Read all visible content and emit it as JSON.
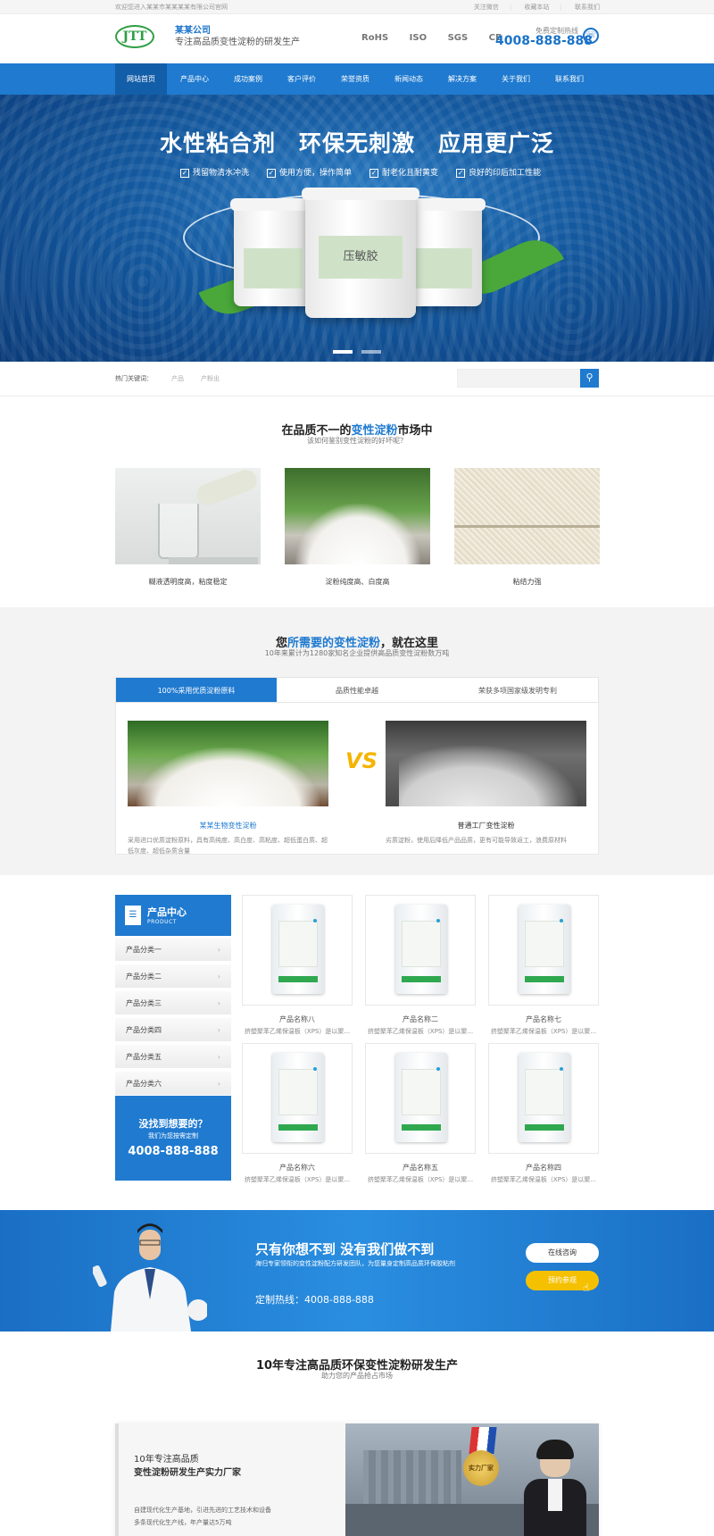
{
  "topbar": {
    "welcome": "欢迎您进入某某市某某某某有限公司官网",
    "links": [
      "关注微信",
      "收藏本站",
      "联系我们"
    ]
  },
  "header": {
    "logo": "JTT",
    "company": "某某公司",
    "slogan": "专注高品质变性淀粉的研发生产",
    "certs": [
      "RoHS",
      "ISO",
      "SGS",
      "CE"
    ],
    "hotline_label": "免费定制热线",
    "hotline": "4008-888-888"
  },
  "nav": {
    "items": [
      "网站首页",
      "产品中心",
      "成功案例",
      "客户评价",
      "荣誉资质",
      "新闻动态",
      "解决方案",
      "关于我们",
      "联系我们"
    ],
    "active_index": 0
  },
  "banner": {
    "headline": "水性粘合剂　环保无刺激　应用更广泛",
    "features": [
      "残留物清水冲洗",
      "使用方便，操作简单",
      "耐老化且耐黄变",
      "良好的印后加工性能"
    ],
    "bucket_labels": [
      "",
      "压敏胶",
      ""
    ],
    "slides": 2,
    "active_slide": 0
  },
  "search": {
    "label": "热门关键词：",
    "keywords": [
      "产品",
      "产粉出"
    ],
    "placeholder": ""
  },
  "quality": {
    "title_pre": "在品质不一的",
    "title_hl": "变性淀粉",
    "title_post": "市场中",
    "subtitle": "该如何鉴别变性淀粉的好坏呢？",
    "items": [
      {
        "caption": "糊液透明度高，粘度稳定"
      },
      {
        "caption": "淀粉纯度高、白度高"
      },
      {
        "caption": "粘结力强"
      }
    ]
  },
  "need": {
    "title_pre": "您",
    "title_hl": "所需要的变性淀粉",
    "title_post": "，就在这里",
    "subtitle": "10年来累计为1280家知名企业提供高品质变性淀粉数万吨",
    "tabs": [
      "100%采用优质淀粉原料",
      "品质性能卓越",
      "荣获多项国家级发明专利"
    ],
    "active_tab": 0,
    "vs": "VS",
    "left": {
      "name": "某某生物变性淀粉",
      "desc": "采用进口优质淀粉原料，具有高纯度、高白度、高粘度、超低蛋白质、超低灰度、超低杂质含量"
    },
    "right": {
      "name": "普通工厂变性淀粉",
      "desc": "劣质淀粉，使用后降低产品品质，更有可能导致返工，浪费原材料"
    }
  },
  "products": {
    "side_title": "产品中心",
    "side_sub": "PRODUCT",
    "categories": [
      "产品分类一",
      "产品分类二",
      "产品分类三",
      "产品分类四",
      "产品分类五",
      "产品分类六"
    ],
    "contact_q": "没找到想要的？",
    "contact_s": "我们为您按需定制",
    "contact_n": "4008-888-888",
    "items": [
      {
        "name": "产品名称八",
        "desc": "挤塑聚苯乙烯保温板（XPS）是以聚..."
      },
      {
        "name": "产品名称二",
        "desc": "挤塑聚苯乙烯保温板（XPS）是以聚..."
      },
      {
        "name": "产品名称七",
        "desc": "挤塑聚苯乙烯保温板（XPS）是以聚..."
      },
      {
        "name": "产品名称六",
        "desc": "挤塑聚苯乙烯保温板（XPS）是以聚..."
      },
      {
        "name": "产品名称五",
        "desc": "挤塑聚苯乙烯保温板（XPS）是以聚..."
      },
      {
        "name": "产品名称四",
        "desc": "挤塑聚苯乙烯保温板（XPS）是以聚..."
      }
    ]
  },
  "cta": {
    "title": "只有你想不到 没有我们做不到",
    "sub": "海归专家领衔的变性淀粉配方研发团队，为您量身定制高品质环保胶粘剂",
    "hotline": "定制热线：4008-888-888",
    "btn_online": "在线咨询",
    "btn_book": "预约参观"
  },
  "about": {
    "title": "10年专注高品质环保变性淀粉研发生产",
    "subtitle": "助力您的产品抢占市场",
    "h1": "10年专注高品质",
    "h2": "变性淀粉研发生产实力厂家",
    "p1": "自建现代化生产基地，引进先进的工艺技术和设备",
    "p2": "多条现代化生产线，年产量达5万吨",
    "badge": "实力厂家"
  },
  "colors": {
    "primary": "#1f7ad0",
    "accent": "#f5c000",
    "green": "#2f9e44"
  }
}
